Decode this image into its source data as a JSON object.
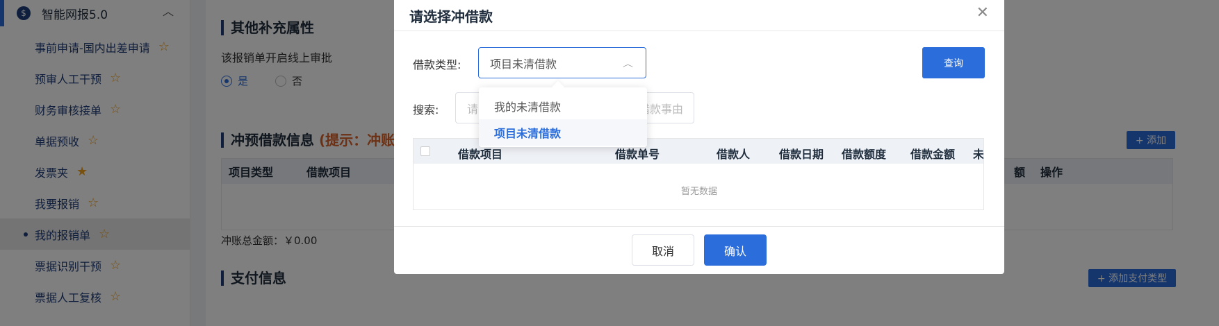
{
  "sidebar": {
    "group_label": "智能网报5.0",
    "items": [
      {
        "label": "事前申请-国内出差申请"
      },
      {
        "label": "预审人工干预"
      },
      {
        "label": "财务审核接单"
      },
      {
        "label": "单据预收"
      },
      {
        "label": "发票夹"
      },
      {
        "label": "我要报销"
      },
      {
        "label": "我的报销单"
      },
      {
        "label": "票据识别干预"
      },
      {
        "label": "票据人工复核"
      }
    ]
  },
  "background": {
    "section1_title": "其他补充属性",
    "online_approval": "该报销单开启线上审批",
    "radio_yes": "是",
    "radio_no": "否",
    "section2_title": "冲预借款信息",
    "section2_hint": "(提示：冲账",
    "add_button": "+ 添加",
    "table_headers": [
      "项目类型",
      "借款项目",
      "额",
      "操作"
    ],
    "total_label": "冲账总金额：￥0.00",
    "section3_title": "支付信息",
    "add_pay_button": "+ 添加支付类型"
  },
  "modal": {
    "title": "请选择冲借款",
    "loan_type_label": "借款类型:",
    "loan_type_value": "项目未清借款",
    "search_label": "搜索:",
    "search_placeholder_a": "请",
    "search_placeholder_b": "借款事由",
    "query_button": "查询",
    "table_headers": [
      "借款项目",
      "借款单号",
      "借款人",
      "借款日期",
      "借款额度",
      "借款金额",
      "未"
    ],
    "empty_text": "暂无数据",
    "cancel_button": "取消",
    "confirm_button": "确认"
  },
  "dropdown": {
    "options": [
      "我的未清借款",
      "项目未清借款"
    ],
    "selected_index": 1
  },
  "colors": {
    "primary": "#2a6ddb",
    "nav_text": "#1f3d7a",
    "warning": "#d9632b",
    "star": "#f0a020"
  }
}
